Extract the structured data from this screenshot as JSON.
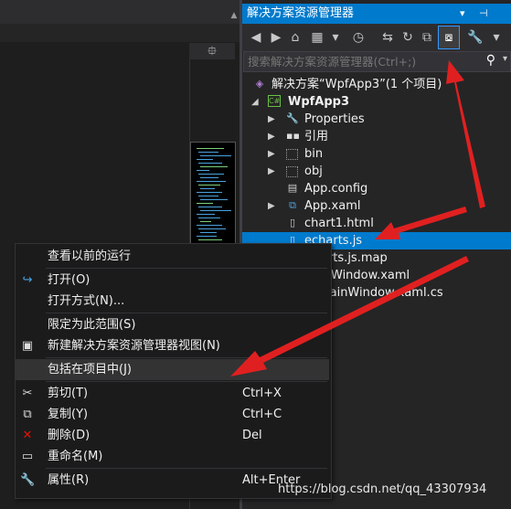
{
  "solution_explorer": {
    "title": "解决方案资源管理器",
    "title_icons": "▾ ⊣ ✕",
    "search_placeholder": "搜索解决方案资源管理器(Ctrl+;)",
    "tree": [
      {
        "label": "解决方案“WpfApp3”(1 个项目)",
        "icon": "solution-icon"
      },
      {
        "label": "WpfApp3",
        "icon": "csharp-project-icon",
        "bold": true
      },
      {
        "label": "Properties",
        "icon": "wrench-icon"
      },
      {
        "label": "引用",
        "icon": "references-icon"
      },
      {
        "label": "bin",
        "icon": "folder-icon"
      },
      {
        "label": "obj",
        "icon": "folder-icon"
      },
      {
        "label": "App.config",
        "icon": "config-file-icon"
      },
      {
        "label": "App.xaml",
        "icon": "xaml-file-icon"
      },
      {
        "label": "chart1.html",
        "icon": "html-file-icon"
      },
      {
        "label": "echarts.js",
        "icon": "js-file-icon"
      },
      {
        "label": "arts.js.map",
        "icon": "file-icon"
      },
      {
        "label": "Window.xaml",
        "icon": "xaml-file-icon"
      },
      {
        "label": "lainWindow.xaml.cs",
        "icon": "cs-file-icon"
      }
    ],
    "colors": {
      "accent": "#007acc",
      "background": "#252526"
    }
  },
  "context_menu": {
    "items": [
      {
        "label": "查看以前的运行",
        "shortcut": "",
        "icon": ""
      },
      {
        "label": "打开(O)",
        "shortcut": "",
        "icon": "open-arrow-icon"
      },
      {
        "label": "打开方式(N)...",
        "shortcut": "",
        "icon": ""
      },
      {
        "label": "限定为此范围(S)",
        "shortcut": "",
        "icon": ""
      },
      {
        "label": "新建解决方案资源管理器视图(N)",
        "shortcut": "",
        "icon": "new-view-icon"
      },
      {
        "label": "包括在项目中(J)",
        "shortcut": "",
        "icon": ""
      },
      {
        "label": "剪切(T)",
        "shortcut": "Ctrl+X",
        "icon": "scissors-icon"
      },
      {
        "label": "复制(Y)",
        "shortcut": "Ctrl+C",
        "icon": "copy-icon"
      },
      {
        "label": "删除(D)",
        "shortcut": "Del",
        "icon": "delete-icon"
      },
      {
        "label": "重命名(M)",
        "shortcut": "",
        "icon": "rename-icon"
      },
      {
        "label": "属性(R)",
        "shortcut": "Alt+Enter",
        "icon": "wrench-icon"
      }
    ]
  },
  "minimap": {
    "header_glyph": "⯐"
  },
  "watermark": "https://blog.csdn.net/qq_43307934"
}
